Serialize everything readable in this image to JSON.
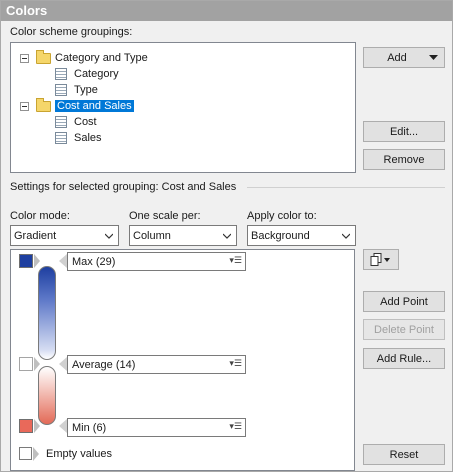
{
  "title": "Colors",
  "groupings_label": "Color scheme groupings:",
  "tree": [
    {
      "label": "Category and Type",
      "children": [
        "Category",
        "Type"
      ]
    },
    {
      "label": "Cost and Sales",
      "children": [
        "Cost",
        "Sales"
      ],
      "selected": true
    }
  ],
  "buttons": {
    "add": "Add",
    "edit": "Edit...",
    "remove": "Remove",
    "add_point": "Add Point",
    "delete_point": "Delete Point",
    "add_rule": "Add Rule...",
    "reset": "Reset"
  },
  "settings_heading": "Settings for selected grouping: Cost and Sales",
  "color_mode": {
    "label": "Color mode:",
    "value": "Gradient"
  },
  "scale_per": {
    "label": "One scale per:",
    "value": "Column"
  },
  "apply_to": {
    "label": "Apply color to:",
    "value": "Background"
  },
  "points": [
    {
      "label": "Max (29)",
      "color": "#1e3fa0"
    },
    {
      "label": "Average (14)",
      "color": "#ffffff"
    },
    {
      "label": "Min (6)",
      "color": "#e9695a"
    }
  ],
  "empty_values": "Empty values",
  "colors": {
    "selection": "#0078d7",
    "header": "#a2a2a2"
  }
}
